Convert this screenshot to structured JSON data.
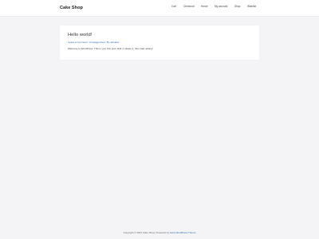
{
  "header": {
    "site_title": "Cake Shop",
    "nav": [
      {
        "label": "Cart"
      },
      {
        "label": "Checkout"
      },
      {
        "label": "Home"
      },
      {
        "label": "My account"
      },
      {
        "label": "Shop"
      },
      {
        "label": "Wishlist"
      }
    ]
  },
  "post": {
    "title": "Hello world!",
    "meta": {
      "comments": "Leave a Comment",
      "category": "Uncategorized",
      "author_prefix": "By",
      "author": "alexalex"
    },
    "body": "Welcome to WordPress. This is your first post. Edit or delete it, then start writing!"
  },
  "footer": {
    "copyright": "Copyright © 2023 Cake Shop | Powered by",
    "theme_link": "Astra WordPress Theme"
  },
  "colors": {
    "background": "#f4f3f6",
    "link": "#2a6cb4"
  }
}
